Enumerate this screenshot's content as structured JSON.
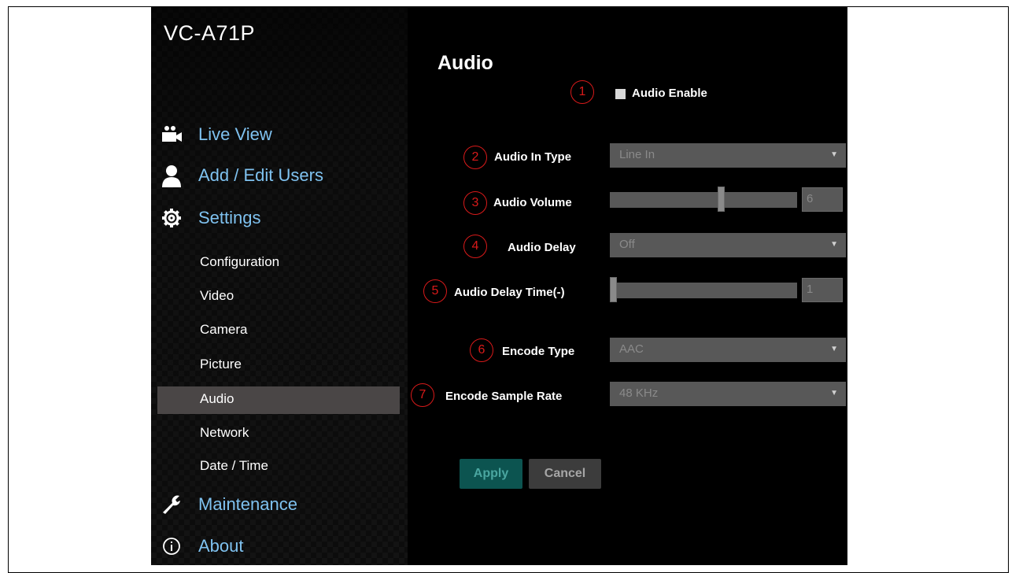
{
  "app": {
    "brand": "VC-A71P",
    "page_title": "Audio"
  },
  "sidebar": {
    "main_items": [
      {
        "label": "Live View",
        "icon": "video-camera-icon"
      },
      {
        "label": "Add / Edit Users",
        "icon": "user-icon"
      },
      {
        "label": "Settings",
        "icon": "gear-icon"
      },
      {
        "label": "Maintenance",
        "icon": "wrench-icon"
      },
      {
        "label": "About",
        "icon": "info-icon"
      }
    ],
    "sub_items": [
      {
        "label": "Configuration"
      },
      {
        "label": "Video"
      },
      {
        "label": "Camera"
      },
      {
        "label": "Picture"
      },
      {
        "label": "Audio",
        "active": true
      },
      {
        "label": "Network"
      },
      {
        "label": "Date / Time"
      }
    ]
  },
  "markers": [
    "1",
    "2",
    "3",
    "4",
    "5",
    "6",
    "7"
  ],
  "form": {
    "audio_enable": {
      "label": "Audio Enable",
      "checked": false
    },
    "audio_in_type": {
      "label": "Audio In Type",
      "value": "Line In"
    },
    "audio_volume": {
      "label": "Audio Volume",
      "value": "6",
      "level": 0.6
    },
    "audio_delay": {
      "label": "Audio Delay",
      "value": "Off"
    },
    "audio_delay_time": {
      "label": "Audio Delay Time(-)",
      "value": "1",
      "level": 0
    },
    "encode_type": {
      "label": "Encode Type",
      "value": "AAC"
    },
    "encode_sample_rate": {
      "label": "Encode Sample Rate",
      "value": "48 KHz"
    }
  },
  "buttons": {
    "apply": "Apply",
    "cancel": "Cancel"
  },
  "colors": {
    "accent_link": "#7fc2f0",
    "marker_red": "#d91a1a",
    "apply_bg": "#0c5450"
  }
}
